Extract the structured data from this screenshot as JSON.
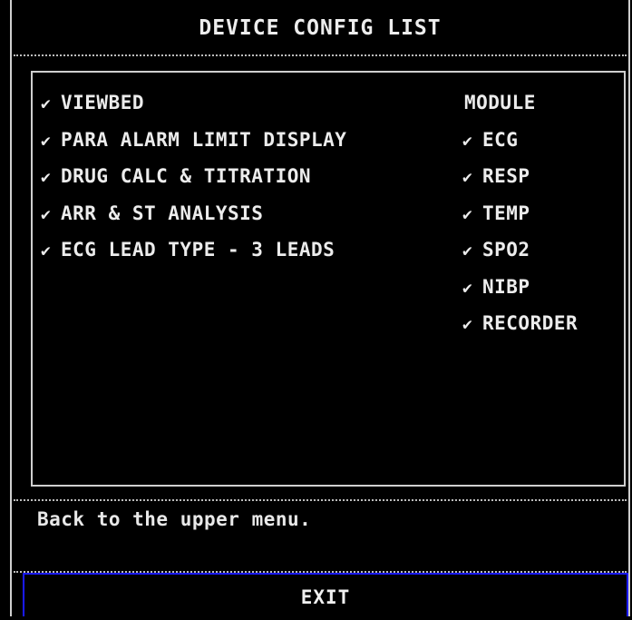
{
  "window": {
    "title": "DEVICE CONFIG LIST"
  },
  "features": [
    {
      "label": "VIEWBED",
      "checked": true
    },
    {
      "label": "PARA ALARM LIMIT DISPLAY",
      "checked": true
    },
    {
      "label": "DRUG CALC & TITRATION",
      "checked": true
    },
    {
      "label": "ARR & ST ANALYSIS",
      "checked": true
    },
    {
      "label": "ECG LEAD TYPE - 3 LEADS",
      "checked": true
    }
  ],
  "modules": {
    "header": "MODULE",
    "items": [
      {
        "label": "ECG",
        "checked": true
      },
      {
        "label": "RESP",
        "checked": true
      },
      {
        "label": "TEMP",
        "checked": true
      },
      {
        "label": "SPO2",
        "checked": true
      },
      {
        "label": "NIBP",
        "checked": true
      },
      {
        "label": "RECORDER",
        "checked": true
      }
    ]
  },
  "icons": {
    "check": "✔"
  },
  "status": {
    "text": "Back to the upper menu."
  },
  "buttons": {
    "exit_label": "EXIT"
  },
  "colors": {
    "background": "#000000",
    "text": "#ececec",
    "exit_border": "#1a1aff"
  }
}
